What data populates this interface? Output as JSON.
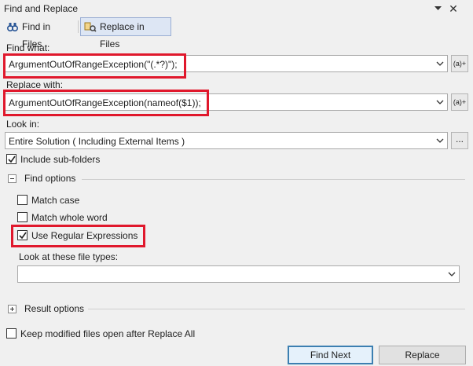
{
  "window": {
    "title": "Find and Replace"
  },
  "tabs": [
    {
      "label": "Find in Files"
    },
    {
      "label": "Replace in Files"
    }
  ],
  "find_what": {
    "label": "Find what:",
    "value": "ArgumentOutOfRangeException(\"(.*?)\");",
    "regex_button": "(a)+"
  },
  "replace_with": {
    "label": "Replace with:",
    "value": "ArgumentOutOfRangeException(nameof($1));",
    "regex_button": "(a)+"
  },
  "look_in": {
    "label": "Look in:",
    "value": "Entire Solution ( Including External Items )",
    "browse_button": "..."
  },
  "include_subfolders": {
    "label": "Include sub-folders",
    "checked": true
  },
  "find_options": {
    "label": "Find options",
    "match_case": {
      "label": "Match case",
      "checked": false
    },
    "match_whole_word": {
      "label": "Match whole word",
      "checked": false
    },
    "use_regex": {
      "label": "Use Regular Expressions",
      "checked": true
    },
    "file_types": {
      "label": "Look at these file types:",
      "value": ""
    }
  },
  "result_options": {
    "label": "Result options"
  },
  "keep_modified": {
    "label": "Keep modified files open after Replace All",
    "checked": false
  },
  "buttons": {
    "find_next": "Find Next",
    "replace": "Replace"
  },
  "colors": {
    "highlight": "#e0182c",
    "tab_active": "#dde6f4",
    "default_button_border": "#3c7fb1"
  }
}
